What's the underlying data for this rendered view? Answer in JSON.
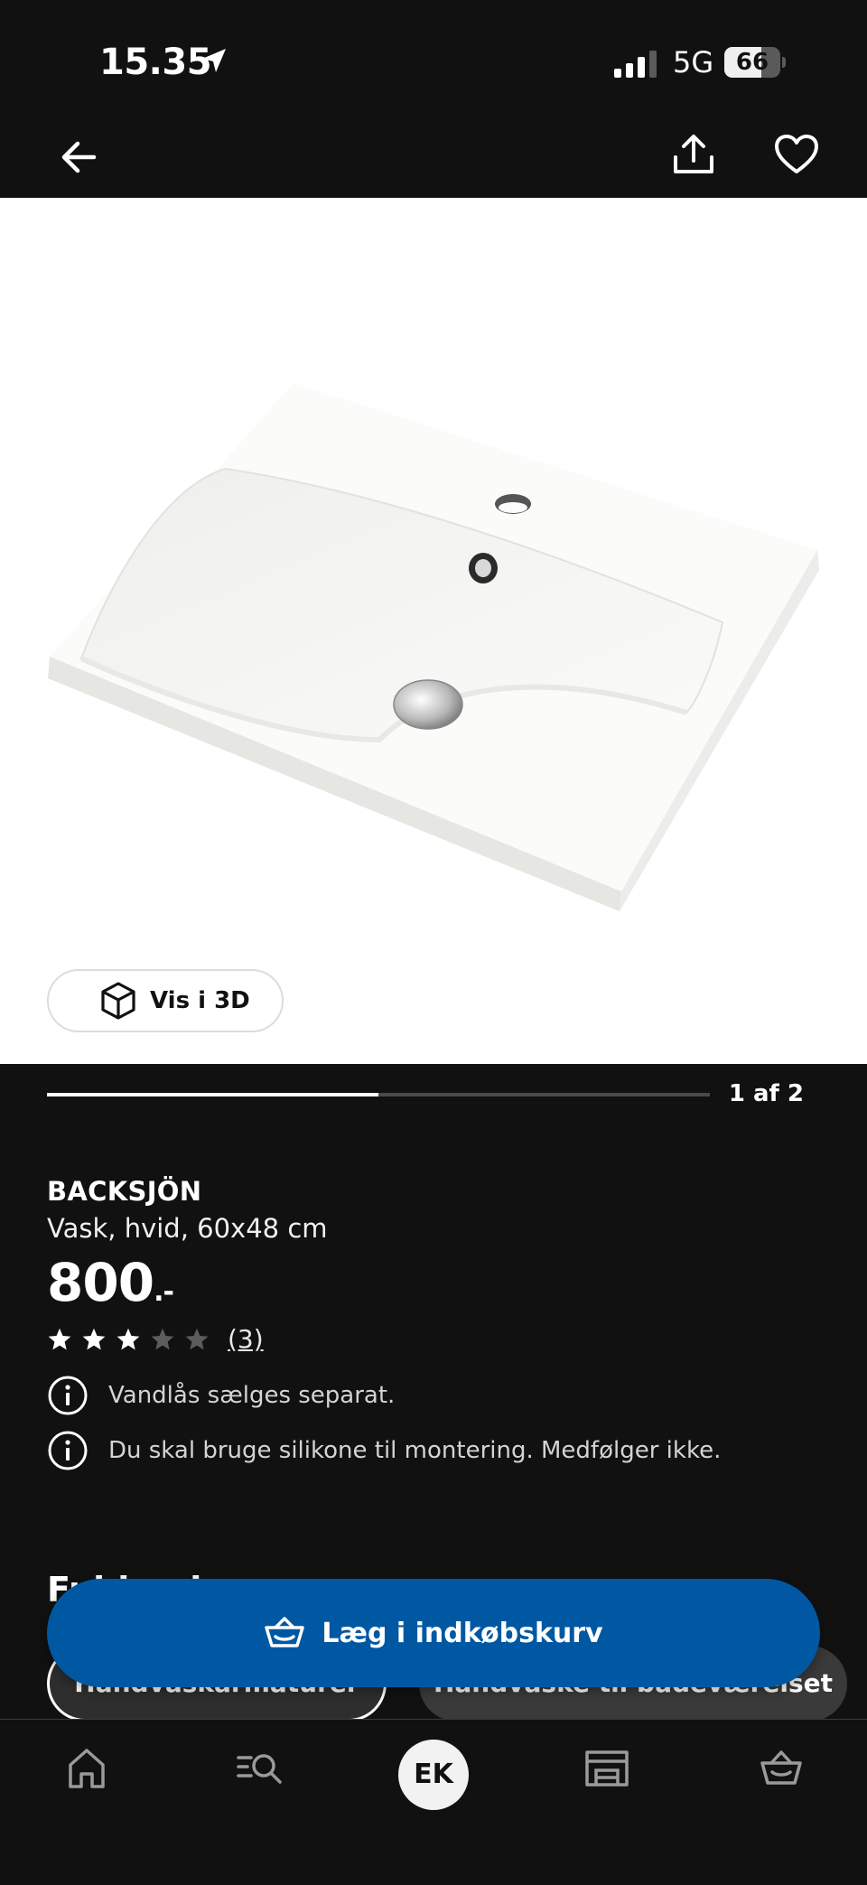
{
  "status_bar": {
    "time": "15.35",
    "network": "5G",
    "battery_level": 66,
    "battery_text": "66"
  },
  "header": {
    "back_icon": "arrow-left-icon",
    "share_icon": "share-icon",
    "favorite_icon": "heart-icon"
  },
  "gallery": {
    "view_3d_label": "Vis i 3D",
    "progress_text": "1 af 2",
    "progress_fraction": 0.5
  },
  "product": {
    "name": "BACKSJÖN",
    "description": "Vask, hvid, 60x48 cm",
    "price": "800",
    "price_suffix": ".-",
    "rating": 3,
    "rating_max": 5,
    "review_count": "(3)",
    "notes": [
      "Vandlås sælges separat.",
      "Du skal bruge silikone til montering. Medfølger ikke."
    ]
  },
  "related": {
    "heading": "Fuldend",
    "chips": [
      "Håndvaskarmaturer",
      "Håndvaske til badeværelset"
    ]
  },
  "cta": {
    "add_to_cart_label": "Læg i indkøbskurv"
  },
  "bottom_nav": {
    "items": [
      "home-icon",
      "search-list-icon",
      "profile-avatar",
      "store-icon",
      "cart-icon"
    ],
    "profile_initials": "EK"
  },
  "colors": {
    "background": "#111111",
    "primary": "#0058a3",
    "white": "#ffffff"
  }
}
